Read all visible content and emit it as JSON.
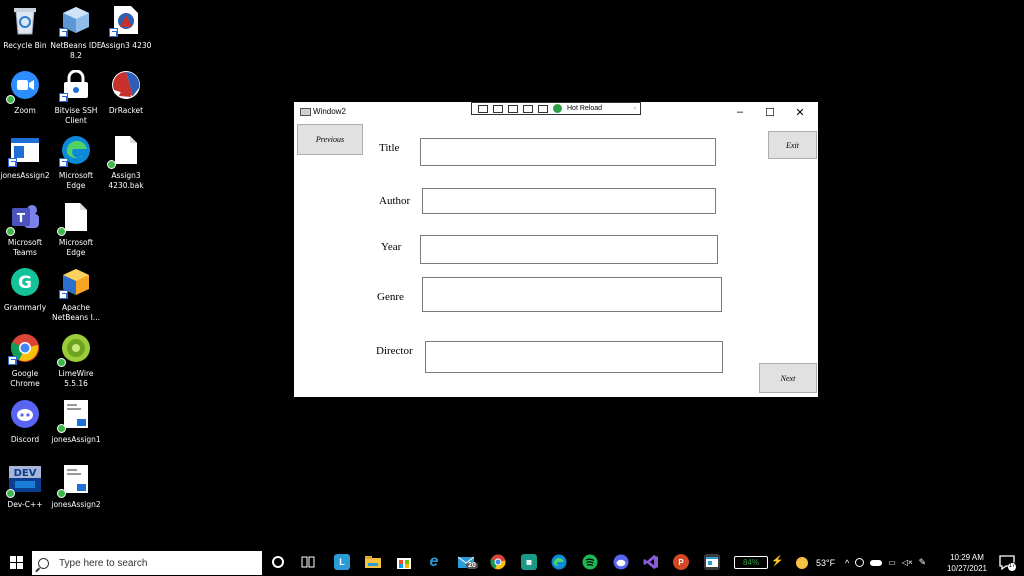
{
  "desktop": {
    "icons": [
      {
        "label": "Recycle Bin"
      },
      {
        "label": "NetBeans IDE\n8.2"
      },
      {
        "label": "Assign3 4230"
      },
      {
        "label": "Zoom"
      },
      {
        "label": "Bitvise SSH\nClient"
      },
      {
        "label": "DrRacket"
      },
      {
        "label": "jonesAssign2"
      },
      {
        "label": "Microsoft\nEdge"
      },
      {
        "label": "Assign3\n4230.bak"
      },
      {
        "label": "Microsoft\nTeams"
      },
      {
        "label": "Microsoft\nEdge"
      },
      {
        "label": "Grammarly"
      },
      {
        "label": "Apache\nNetBeans I..."
      },
      {
        "label": "Google\nChrome"
      },
      {
        "label": "LimeWire\n5.5.16"
      },
      {
        "label": "Discord"
      },
      {
        "label": "jonesAssign1"
      },
      {
        "label": "Dev-C++"
      },
      {
        "label": "jonesAssign2"
      }
    ],
    "dev_badge": "DEV"
  },
  "window": {
    "title": "Window2",
    "hot_reload": "Hot Reload",
    "minimize": "–",
    "maximize": "☐",
    "close": "✕",
    "previous_button": "Previous",
    "exit_button": "Exit",
    "next_button": "Next",
    "fields": [
      {
        "label": "Title",
        "value": ""
      },
      {
        "label": "Author",
        "value": ""
      },
      {
        "label": "Year",
        "value": ""
      },
      {
        "label": "Genre",
        "value": ""
      },
      {
        "label": "Director",
        "value": ""
      }
    ]
  },
  "taskbar": {
    "search_placeholder": "Type here to search",
    "mail_badge": "20",
    "battery": "84%",
    "weather": "53°F",
    "time": "10:29 AM",
    "date": "10/27/2021",
    "notifications": "17"
  }
}
